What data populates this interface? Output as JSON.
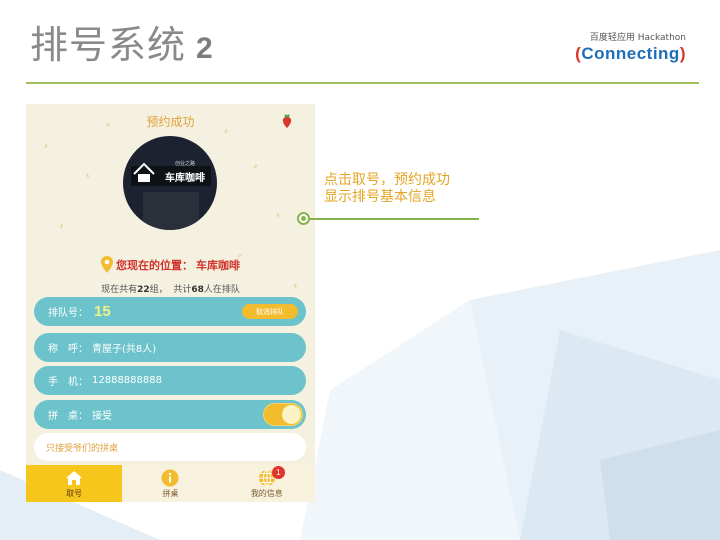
{
  "slide": {
    "title": "排号系统",
    "title_number": "2"
  },
  "brand": {
    "top_text": "百度轻应用 Hackathon",
    "logo_text": "Connecting"
  },
  "callout": {
    "line1": "点击取号，预约成功",
    "line2": "显示排号基本信息"
  },
  "app": {
    "header_title": "预约成功",
    "photo_sign_text": "车库咖啡",
    "photo_small_text": "创业之路",
    "location_label": "您现在的位置：",
    "location_name": "车库咖啡",
    "count_prefix": "现在共有",
    "group_count": "22",
    "group_unit": "组，",
    "people_prefix": "共计",
    "people_count": "68",
    "people_suffix": "人在排队",
    "queue_label": "排队号：",
    "queue_number": "15",
    "cancel_label": "取消排队",
    "name_label": "称　呼：",
    "name_value": "青屋子(共8人)",
    "phone_label": "手　机：",
    "phone_value": "12888888888",
    "share_label": "拼　桌：",
    "share_value": "接受",
    "share_enabled": true,
    "note_text": "只接受爷们的拼桌",
    "tabs": [
      {
        "label": "取号",
        "icon": "home-icon",
        "active": true
      },
      {
        "label": "拼桌",
        "icon": "info-icon",
        "active": false
      },
      {
        "label": "我的信息",
        "icon": "globe-icon",
        "active": false,
        "badge": "1"
      }
    ]
  },
  "colors": {
    "accent_green": "#9dc05a",
    "row_teal": "#6cc3cb",
    "button_yellow": "#f2bc2e",
    "callout_orange": "#e4a526",
    "location_red": "#d0342c"
  }
}
